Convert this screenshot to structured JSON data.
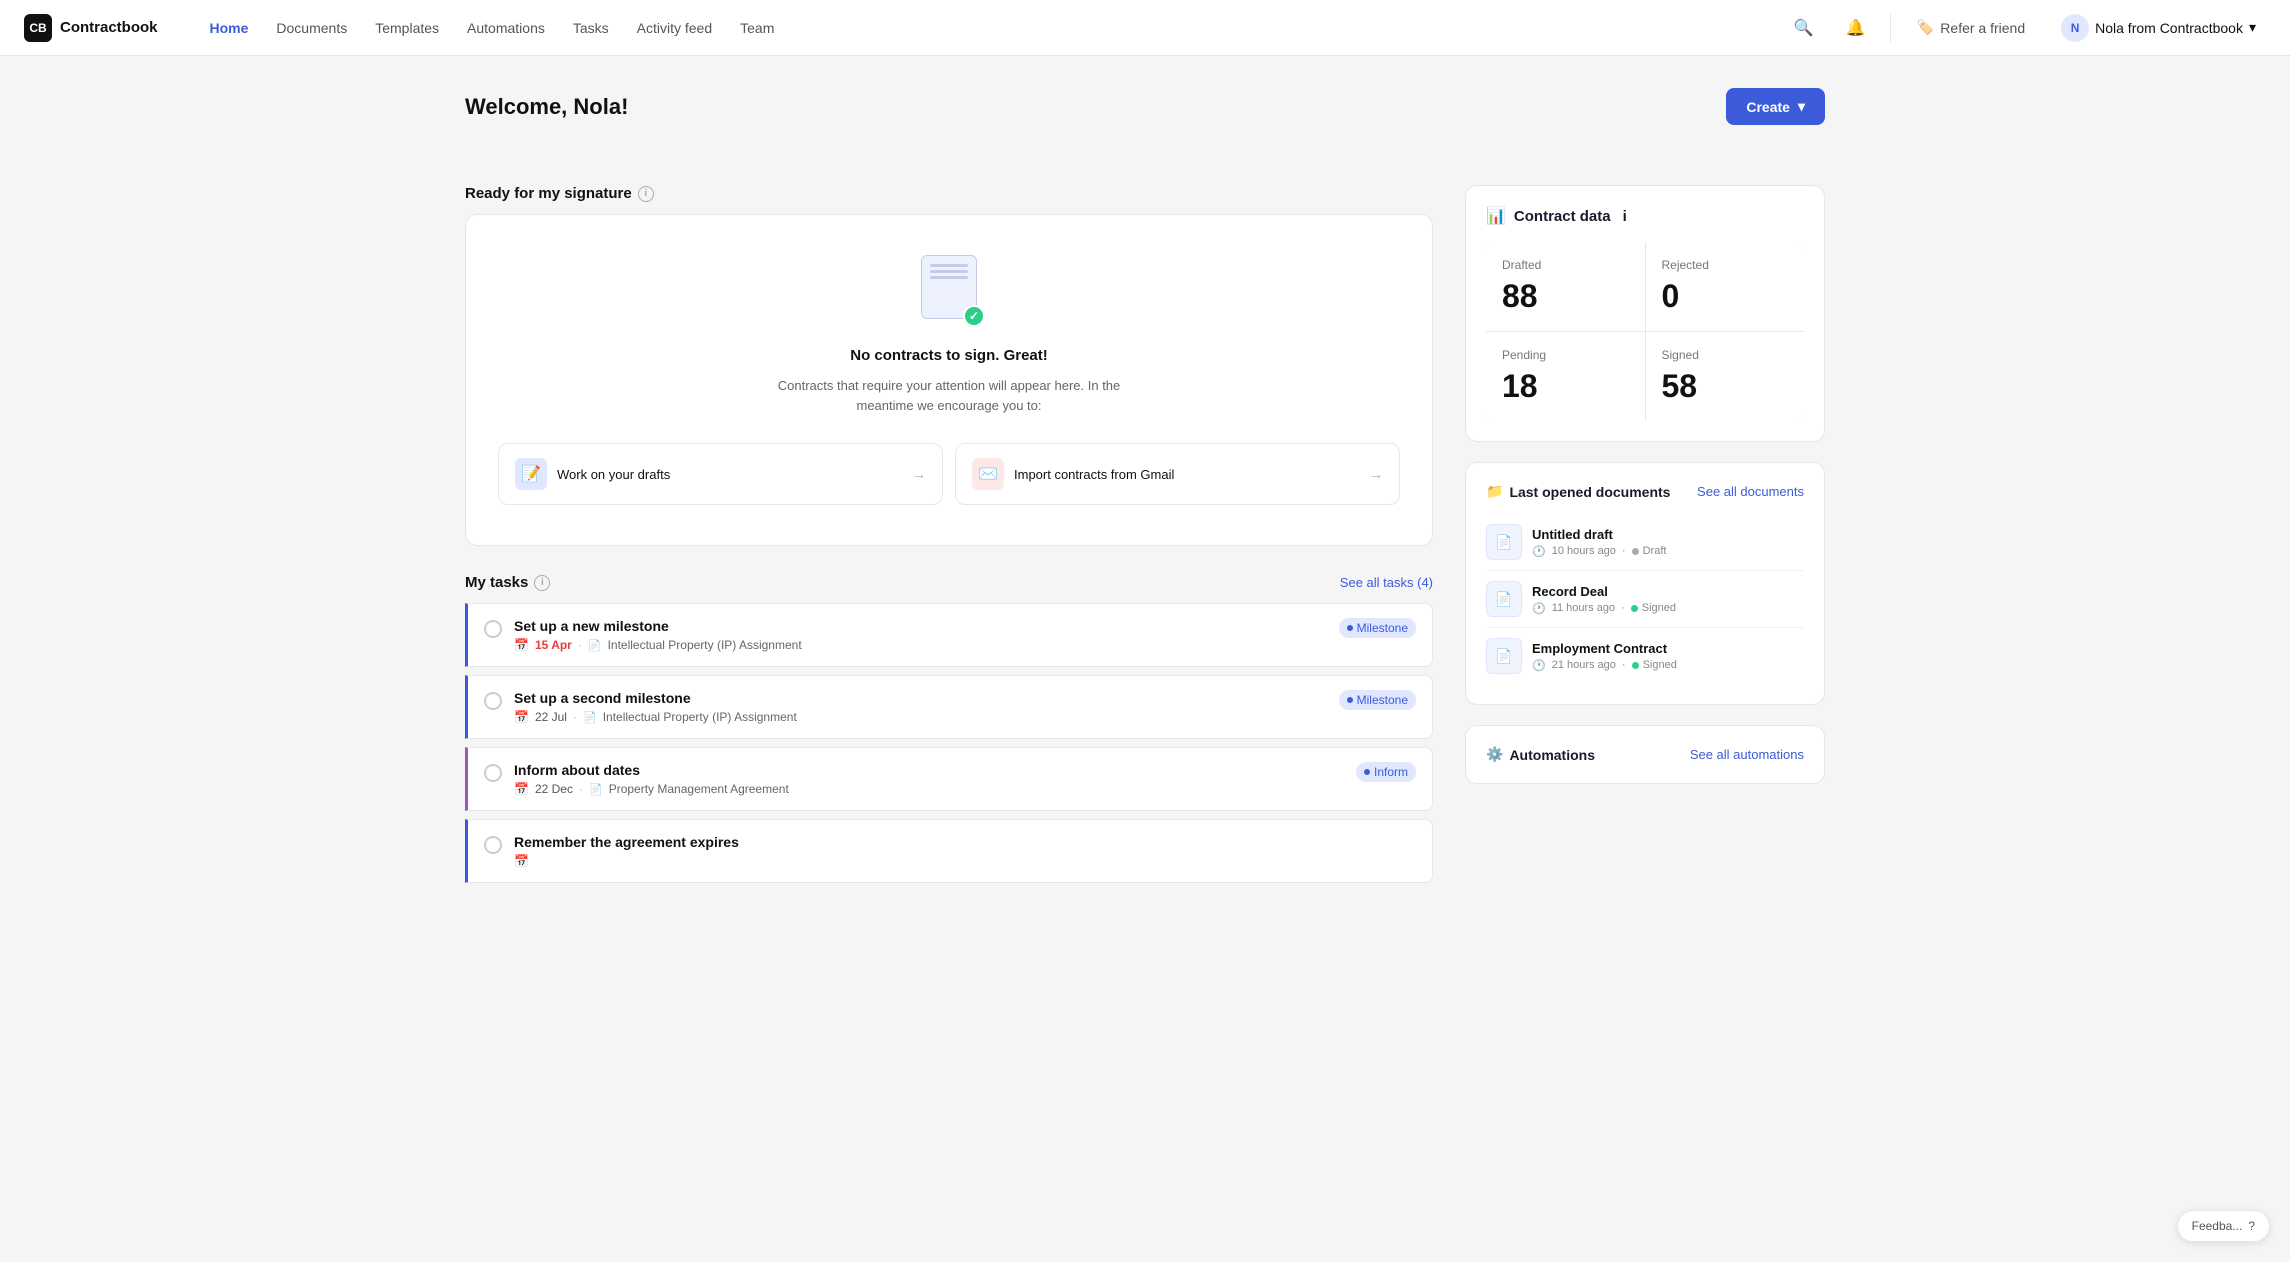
{
  "nav": {
    "logo_text": "Contractbook",
    "links": [
      {
        "label": "Home",
        "active": true
      },
      {
        "label": "Documents",
        "active": false
      },
      {
        "label": "Templates",
        "active": false
      },
      {
        "label": "Automations",
        "active": false
      },
      {
        "label": "Tasks",
        "active": false
      },
      {
        "label": "Activity feed",
        "active": false
      },
      {
        "label": "Team",
        "active": false
      }
    ],
    "refer_label": "Refer a friend",
    "user_name": "Nola from Contractbook"
  },
  "welcome": {
    "title": "Welcome, Nola!",
    "create_label": "Create"
  },
  "ready_section": {
    "title": "Ready for my signature",
    "no_contracts_title": "No contracts to sign. Great!",
    "no_contracts_desc": "Contracts that require your attention will appear here. In the meantime we encourage you to:",
    "action_drafts_label": "Work on your drafts",
    "action_gmail_label": "Import contracts from Gmail"
  },
  "tasks_section": {
    "title": "My tasks",
    "see_all_label": "See all tasks (4)",
    "tasks": [
      {
        "title": "Set up a new milestone",
        "date": "15 Apr",
        "date_red": true,
        "doc": "Intellectual Property (IP) Assignment",
        "badge": "Milestone",
        "border_color": "#3b5bdb"
      },
      {
        "title": "Set up a second milestone",
        "date": "22 Jul",
        "date_red": false,
        "doc": "Intellectual Property (IP) Assignment",
        "badge": "Milestone",
        "border_color": "#3b5bdb"
      },
      {
        "title": "Inform about dates",
        "date": "22 Dec",
        "date_red": false,
        "doc": "Property Management Agreement",
        "badge": "Inform",
        "border_color": "#9b59b6"
      },
      {
        "title": "Remember the agreement expires",
        "date": "",
        "date_red": false,
        "doc": "",
        "badge": "",
        "border_color": "#3b5bdb"
      }
    ]
  },
  "contract_data": {
    "title": "Contract data",
    "stats": [
      {
        "label": "Drafted",
        "value": "88"
      },
      {
        "label": "Rejected",
        "value": "0"
      },
      {
        "label": "Pending",
        "value": "18"
      },
      {
        "label": "Signed",
        "value": "58"
      }
    ]
  },
  "last_docs": {
    "title": "Last opened documents",
    "see_all_label": "See all documents",
    "docs": [
      {
        "name": "Untitled draft",
        "time": "10 hours ago",
        "status": "Draft",
        "status_type": "draft"
      },
      {
        "name": "Record Deal",
        "time": "11 hours ago",
        "status": "Signed",
        "status_type": "signed"
      },
      {
        "name": "Employment Contract",
        "time": "21 hours ago",
        "status": "Signed",
        "status_type": "signed"
      }
    ]
  },
  "automations": {
    "title": "Automations",
    "see_all_label": "See all automations"
  },
  "feedback": {
    "label": "Feedba...",
    "help_label": "?"
  }
}
